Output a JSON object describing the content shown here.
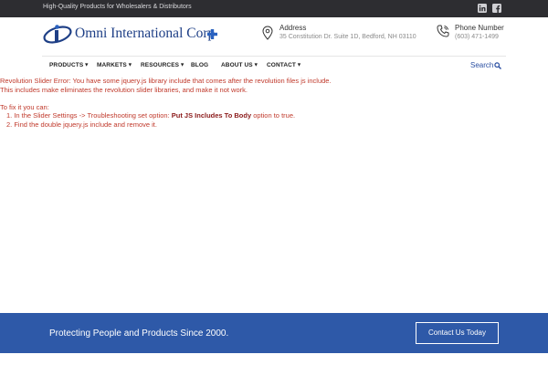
{
  "topbar": {
    "tagline": "High-Quality Products for Wholesalers & Distributors",
    "social": [
      "linkedin-icon",
      "facebook-icon"
    ],
    "bg_color": "#2d2d31"
  },
  "header": {
    "brand": "Omni International Corp",
    "brand_color": "#1e3f86",
    "cross_color": "#2a62c0",
    "address": {
      "title": "Address",
      "value": "35 Constitution Dr. Suite 1D, Bedford, NH 03110"
    },
    "phone": {
      "title": "Phone Number",
      "value": "(603) 471-1499"
    }
  },
  "nav": {
    "items": [
      {
        "label": "PRODUCTS",
        "dropdown": true
      },
      {
        "label": "MARKETS",
        "dropdown": true
      },
      {
        "label": "RESOURCES",
        "dropdown": true
      },
      {
        "label": "BLOG",
        "dropdown": false
      },
      {
        "label": "ABOUT US",
        "dropdown": true
      },
      {
        "label": "CONTACT",
        "dropdown": true
      }
    ],
    "search_label": "Search"
  },
  "error": {
    "line1": "Revolution Slider Error: You have some jquery.js library include that comes after the revolution files js include.",
    "line2": "This includes make eliminates the revolution slider libraries, and make it not work.",
    "fix_intro": "To fix it you can:",
    "step1_prefix": "1. In the Slider Settings -> Troubleshooting set option: ",
    "step1_bold": "Put JS Includes To Body",
    "step1_suffix": " option to true.",
    "step2": "2. Find the double jquery.js include and remove it.",
    "color": "#c0392b"
  },
  "footer": {
    "slogan": "Protecting People and Products Since 2000.",
    "cta": "Contact Us Today",
    "bg_color": "#2e59a8"
  }
}
